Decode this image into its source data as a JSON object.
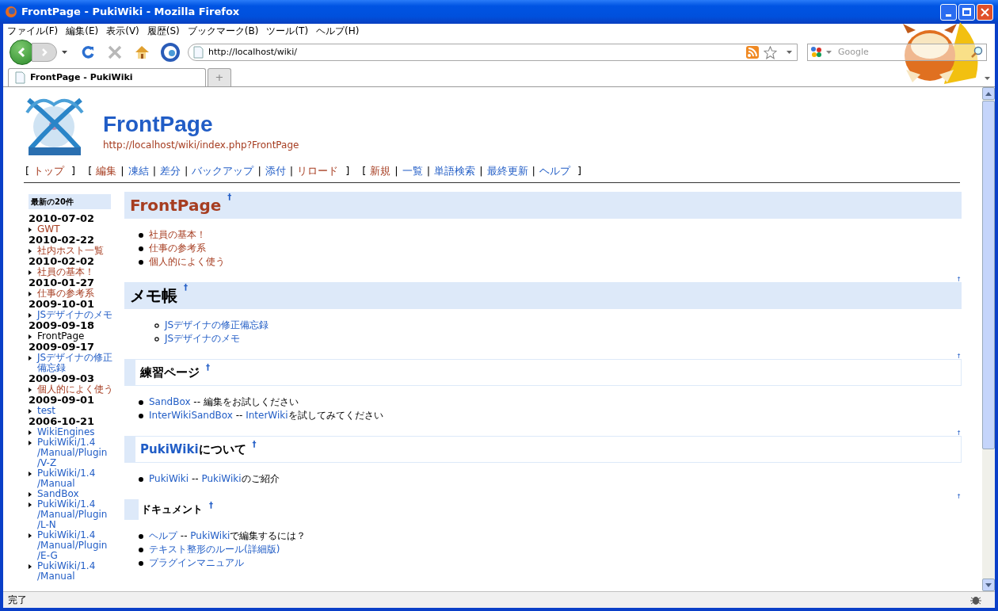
{
  "window": {
    "title": "FrontPage - PukiWiki - Mozilla Firefox"
  },
  "menu": [
    "ファイル(F)",
    "編集(E)",
    "表示(V)",
    "履歴(S)",
    "ブックマーク(B)",
    "ツール(T)",
    "ヘルプ(H)"
  ],
  "toolbar": {
    "url": "http://localhost/wiki/",
    "search_placeholder": "Google",
    "forward_disabled": true
  },
  "tabs": [
    {
      "label": "FrontPage - PukiWiki",
      "selected": true
    },
    {
      "label": "+",
      "selected": false
    }
  ],
  "page": {
    "title": "FrontPage",
    "url": "http://localhost/wiki/index.php?FrontPage",
    "nav": [
      {
        "open": "[",
        "close": "]",
        "items": [
          {
            "label": "トップ",
            "visited": true
          }
        ]
      },
      {
        "open": "[",
        "close": "]",
        "items": [
          {
            "label": "編集",
            "visited": true
          },
          {
            "sep": "|",
            "label": "凍結",
            "visited": false
          },
          {
            "sep": "|",
            "label": "差分",
            "visited": false
          },
          {
            "sep": "|",
            "label": "バックアップ",
            "visited": false
          },
          {
            "sep": "|",
            "label": "添付",
            "visited": false
          },
          {
            "sep": "|",
            "label": "リロード",
            "visited": true
          }
        ]
      },
      {
        "open": "[",
        "close": "]",
        "items": [
          {
            "label": "新規",
            "visited": true
          },
          {
            "sep": "|",
            "label": "一覧",
            "visited": false
          },
          {
            "sep": "|",
            "label": "単語検索",
            "visited": false
          },
          {
            "sep": "|",
            "label": "最終更新",
            "visited": false
          },
          {
            "sep": "|",
            "label": "ヘルプ",
            "visited": false
          }
        ]
      }
    ]
  },
  "sidebar": {
    "title": "最新の20件",
    "groups": [
      {
        "date": "2010-07-02",
        "items": [
          {
            "label": "GWT",
            "kind": "visited"
          }
        ]
      },
      {
        "date": "2010-02-22",
        "items": [
          {
            "label": "社内ホスト一覧",
            "kind": "visited"
          }
        ]
      },
      {
        "date": "2010-02-02",
        "items": [
          {
            "label": "社員の基本！",
            "kind": "visited"
          }
        ]
      },
      {
        "date": "2010-01-27",
        "items": [
          {
            "label": "仕事の参考系",
            "kind": "visited"
          }
        ]
      },
      {
        "date": "2009-10-01",
        "items": [
          {
            "label": "JSデザイナのメモ",
            "kind": "link"
          }
        ]
      },
      {
        "date": "2009-09-18",
        "items": [
          {
            "label": "FrontPage",
            "kind": "current"
          }
        ]
      },
      {
        "date": "2009-09-17",
        "items": [
          {
            "label": "JSデザイナの修正備忘録",
            "kind": "link"
          }
        ]
      },
      {
        "date": "2009-09-03",
        "items": [
          {
            "label": "個人的によく使う",
            "kind": "visited"
          }
        ]
      },
      {
        "date": "2009-09-01",
        "items": [
          {
            "label": "test",
            "kind": "link"
          }
        ]
      },
      {
        "date": "2006-10-21",
        "items": [
          {
            "label": "WikiEngines",
            "kind": "link"
          },
          {
            "label": "PukiWiki/1.4/Manual/Plugin/V-Z",
            "kind": "link"
          },
          {
            "label": "PukiWiki/1.4/Manual",
            "kind": "link"
          },
          {
            "label": "SandBox",
            "kind": "link"
          },
          {
            "label": "PukiWiki/1.4/Manual/Plugin/L-N",
            "kind": "link"
          },
          {
            "label": "PukiWiki/1.4/Manual/Plugin/E-G",
            "kind": "link"
          },
          {
            "label": "PukiWiki/1.4/Manual",
            "kind": "link"
          }
        ]
      }
    ]
  },
  "sections": [
    {
      "kind": "h2",
      "heading": [
        {
          "text": "FrontPage",
          "kind": "visited"
        }
      ],
      "anchor": "†",
      "list": {
        "nested": false,
        "items": [
          [
            {
              "text": "社員の基本！",
              "kind": "visited"
            }
          ],
          [
            {
              "text": "仕事の参考系",
              "kind": "visited"
            }
          ],
          [
            {
              "text": "個人的によく使う",
              "kind": "visited"
            }
          ]
        ]
      }
    },
    {
      "kind": "h2",
      "top_link": "↑",
      "heading": [
        {
          "text": "メモ帳",
          "kind": "text"
        }
      ],
      "anchor": "†",
      "list": {
        "nested": true,
        "items": [
          [
            {
              "text": "JSデザイナの修正備忘録",
              "kind": "link"
            }
          ],
          [
            {
              "text": "JSデザイナのメモ",
              "kind": "link"
            }
          ]
        ]
      }
    },
    {
      "kind": "h3",
      "top_link": "↑",
      "heading": [
        {
          "text": "練習ページ",
          "kind": "text"
        }
      ],
      "anchor": "†",
      "list": {
        "nested": false,
        "items": [
          [
            {
              "text": "SandBox",
              "kind": "link"
            },
            {
              "text": " -- 編集をお試しください",
              "kind": "text"
            }
          ],
          [
            {
              "text": "InterWikiSandBox",
              "kind": "link"
            },
            {
              "text": " -- ",
              "kind": "text"
            },
            {
              "text": "InterWiki",
              "kind": "link"
            },
            {
              "text": "を試してみてください",
              "kind": "text"
            }
          ]
        ]
      }
    },
    {
      "kind": "h3",
      "top_link": "↑",
      "heading": [
        {
          "text": "PukiWiki",
          "kind": "link"
        },
        {
          "text": "について",
          "kind": "text"
        }
      ],
      "anchor": "†",
      "list": {
        "nested": false,
        "items": [
          [
            {
              "text": "PukiWiki",
              "kind": "link"
            },
            {
              "text": " -- ",
              "kind": "text"
            },
            {
              "text": "PukiWiki",
              "kind": "link"
            },
            {
              "text": "のご紹介",
              "kind": "text"
            }
          ]
        ]
      }
    },
    {
      "kind": "h4",
      "top_link": "↑",
      "heading": [
        {
          "text": "ドキュメント",
          "kind": "text"
        }
      ],
      "anchor": "†",
      "list": {
        "nested": false,
        "items": [
          [
            {
              "text": "ヘルプ",
              "kind": "link"
            },
            {
              "text": " -- ",
              "kind": "text"
            },
            {
              "text": "PukiWiki",
              "kind": "link"
            },
            {
              "text": "で編集するには？",
              "kind": "text"
            }
          ],
          [
            {
              "text": "テキスト整形のルール(詳細版)",
              "kind": "link"
            }
          ],
          [
            {
              "text": "プラグインマニュアル",
              "kind": "link"
            }
          ]
        ]
      }
    }
  ],
  "status_bar": {
    "text": "完了"
  }
}
